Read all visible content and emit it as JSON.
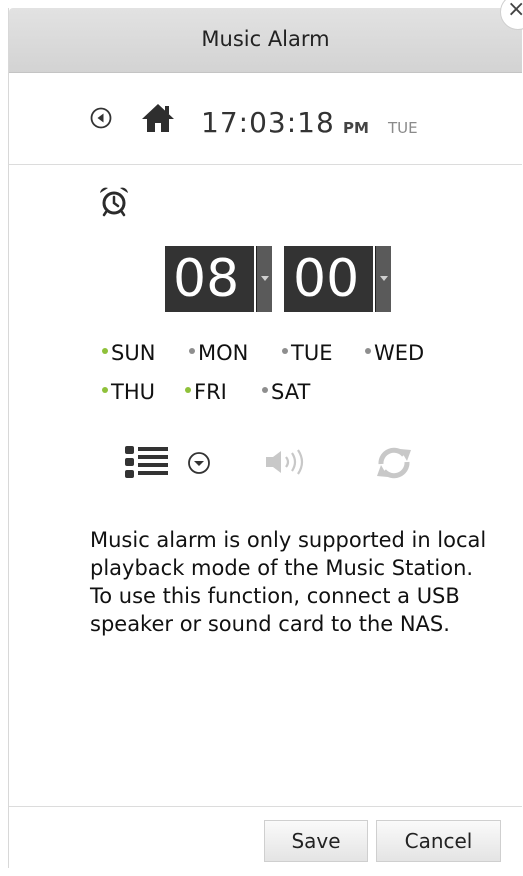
{
  "dialog": {
    "title": "Music Alarm",
    "close_label": "×"
  },
  "clock": {
    "time": "17:03:18",
    "ampm": "PM",
    "weekday": "TUE"
  },
  "alarm": {
    "hour": "08",
    "minute": "00"
  },
  "days": [
    {
      "label": "SUN",
      "enabled": true
    },
    {
      "label": "MON",
      "enabled": false
    },
    {
      "label": "TUE",
      "enabled": false
    },
    {
      "label": "WED",
      "enabled": false
    },
    {
      "label": "THU",
      "enabled": true
    },
    {
      "label": "FRI",
      "enabled": true
    },
    {
      "label": "SAT",
      "enabled": false
    }
  ],
  "message": "Music alarm is only supported in local playback mode of the Music Station. To use this function, connect a USB speaker or sound card to the NAS.",
  "footer": {
    "save_label": "Save",
    "cancel_label": "Cancel"
  },
  "icons": {
    "back": "back-icon",
    "home": "home-icon",
    "alarm": "alarm-clock-icon",
    "playlist": "playlist-icon",
    "dropdown": "dropdown-icon",
    "volume": "volume-icon",
    "repeat": "repeat-icon"
  },
  "colors": {
    "day_enabled": "#8fc13a",
    "day_disabled": "#8e8e8e",
    "digit_bg": "#333333",
    "titlebar": "#d9d9d9",
    "disabled_icon": "#c8c8c8"
  }
}
